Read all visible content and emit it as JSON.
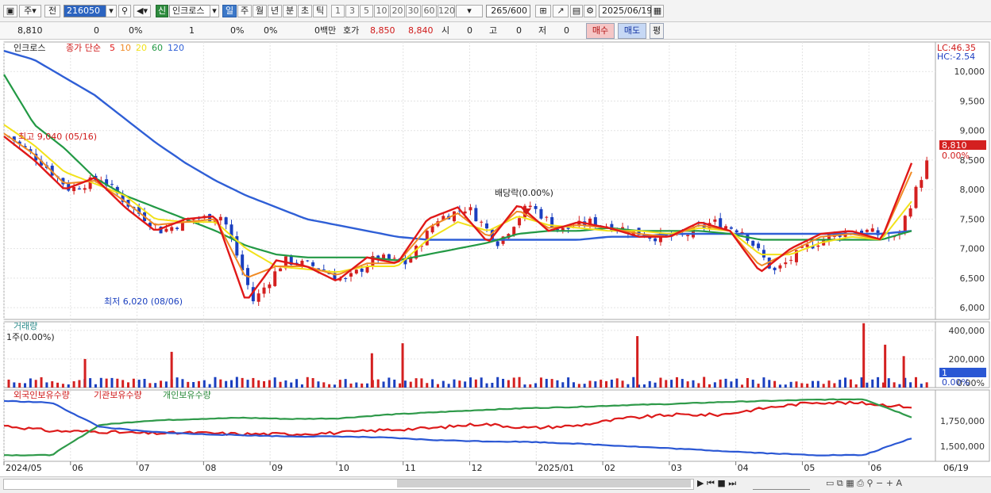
{
  "toolbar": {
    "period_unit": "주",
    "prev_label": "전",
    "stock_code": "216050",
    "credit_badge": "신",
    "stock_name": "인크로스",
    "timeframes": [
      "일",
      "주",
      "월",
      "년",
      "분",
      "초",
      "틱"
    ],
    "active_timeframe": "일",
    "minute_steps": [
      "1",
      "3",
      "5",
      "10",
      "20",
      "30",
      "60",
      "120"
    ],
    "bar_count": "265",
    "bar_total": "/600",
    "date": "2025/06/19"
  },
  "quote_bar": {
    "price": "8,810",
    "change": "0",
    "change_pct": "0%",
    "volume": "1",
    "vol_pct_1": "0%",
    "vol_pct_2": "0%",
    "amount": "0백만",
    "ask_label": "호가",
    "ask": "8,850",
    "bid": "8,840",
    "open_label": "시",
    "open": "0",
    "high_label": "고",
    "high": "0",
    "low_label": "저",
    "low": "0",
    "buy_label": "매수",
    "sell_label": "매도",
    "avg_label": "평"
  },
  "price_panel": {
    "name_tag": "인크로스",
    "ma_label": "종가 단순",
    "ma_periods": [
      "5",
      "10",
      "20",
      "60",
      "120"
    ],
    "lc": "LC:46.35",
    "hc": "HC:-2.54",
    "high_annotation": "최고 9,040 (05/16)",
    "low_annotation": "최저 6,020 (08/06)",
    "dividend_annotation": "배당락(0.00%)",
    "current_price_tag": "8,810",
    "current_pct_tag": "0.00%"
  },
  "volume_panel": {
    "title": "거래량",
    "unit_line": "1주(0.00%)",
    "current_tag": "1",
    "pct_tag": "0.00%"
  },
  "holdings_panel": {
    "series_labels": [
      "외국인보유수량",
      "기관보유수량",
      "개인보유수량"
    ]
  },
  "x_axis": {
    "labels": [
      "2024/05",
      "06",
      "07",
      "08",
      "09",
      "10",
      "11",
      "12",
      "2025/01",
      "02",
      "03",
      "04",
      "05",
      "06"
    ],
    "right_label": "06/19"
  },
  "colors": {
    "candle_up": "#d42020",
    "candle_down": "#1a3fbf",
    "ma5": "#e01818",
    "ma10": "#f08a24",
    "ma20": "#f2e21a",
    "ma60": "#229944",
    "ma120": "#2f5fd6",
    "foreign": "#dd1a1a",
    "institution": "#2f9a4a",
    "individual": "#2a57d4"
  },
  "chart_data": [
    {
      "type": "candlestick",
      "title": "인크로스",
      "y_ticks": [
        6000,
        6500,
        7000,
        7500,
        8000,
        8500,
        9000,
        9500,
        10000
      ],
      "ylim": [
        5800,
        10500
      ],
      "tick_labels": [
        "6,000",
        "6,500",
        "7,000",
        "7,500",
        "8,000",
        "8,500",
        "9,000",
        "9,500",
        "10,000"
      ],
      "x": [
        "2024/05",
        "06",
        "07",
        "08",
        "09",
        "10",
        "11",
        "12",
        "2025/01",
        "02",
        "03",
        "04",
        "05",
        "06"
      ],
      "close_path": [
        8900,
        8500,
        8000,
        8200,
        7700,
        7300,
        7500,
        7550,
        6100,
        6800,
        6700,
        6450,
        6850,
        6750,
        7500,
        7700,
        7100,
        7750,
        7300,
        7450,
        7350,
        7200,
        7200,
        7450,
        7300,
        6600,
        7000,
        7250,
        7300,
        7150,
        8450
      ],
      "series": [
        {
          "name": "5",
          "values": [
            8900,
            8500,
            8000,
            8200,
            7700,
            7300,
            7500,
            7550,
            6100,
            6800,
            6700,
            6450,
            6850,
            6750,
            7500,
            7700,
            7100,
            7750,
            7300,
            7450,
            7350,
            7200,
            7200,
            7450,
            7300,
            6600,
            7000,
            7250,
            7300,
            7150,
            8450
          ]
        },
        {
          "name": "10",
          "values": [
            8950,
            8600,
            8100,
            8150,
            7800,
            7400,
            7450,
            7500,
            6500,
            6700,
            6700,
            6550,
            6750,
            6750,
            7350,
            7600,
            7200,
            7650,
            7350,
            7400,
            7350,
            7250,
            7200,
            7400,
            7300,
            6700,
            6950,
            7200,
            7250,
            7150,
            8300
          ]
        },
        {
          "name": "20",
          "values": [
            9100,
            8750,
            8300,
            8100,
            7900,
            7500,
            7450,
            7450,
            7000,
            6700,
            6650,
            6600,
            6700,
            6700,
            7150,
            7450,
            7300,
            7550,
            7400,
            7350,
            7300,
            7300,
            7250,
            7350,
            7300,
            6900,
            6900,
            7100,
            7200,
            7150,
            7800
          ]
        },
        {
          "name": "60",
          "values": [
            9950,
            9100,
            8700,
            8200,
            7900,
            7700,
            7500,
            7300,
            7050,
            6900,
            6850,
            6850,
            6850,
            6800,
            6900,
            7000,
            7100,
            7250,
            7300,
            7300,
            7350,
            7300,
            7300,
            7300,
            7250,
            7150,
            7150,
            7150,
            7150,
            7150,
            7300
          ]
        },
        {
          "name": "120",
          "values": [
            10350,
            10200,
            9900,
            9600,
            9200,
            8800,
            8450,
            8150,
            7900,
            7700,
            7500,
            7400,
            7300,
            7200,
            7150,
            7150,
            7150,
            7150,
            7150,
            7150,
            7200,
            7200,
            7250,
            7250,
            7250,
            7250,
            7250,
            7250,
            7250,
            7250,
            7300
          ]
        }
      ]
    },
    {
      "type": "bar",
      "title": "거래량",
      "y_ticks": [
        0,
        200000,
        400000
      ],
      "tick_labels": [
        "0.00%",
        "200,000",
        "400,000"
      ],
      "ylim": [
        0,
        460000
      ],
      "spikes": [
        {
          "x": 0.087,
          "value": 200000
        },
        {
          "x": 0.18,
          "value": 250000
        },
        {
          "x": 0.395,
          "value": 240000
        },
        {
          "x": 0.428,
          "value": 310000
        },
        {
          "x": 0.68,
          "value": 360000
        },
        {
          "x": 0.923,
          "value": 450000
        },
        {
          "x": 0.946,
          "value": 300000
        },
        {
          "x": 0.966,
          "value": 220000
        }
      ]
    },
    {
      "type": "line",
      "title": "외국인보유수량 / 기관보유수량 / 개인보유수량",
      "y_ticks": [
        1500000,
        1750000
      ],
      "tick_labels": [
        "1,500,000",
        "1,750,000"
      ],
      "series": [
        {
          "name": "외국인보유수량",
          "values": [
            0.54,
            0.45,
            0.44,
            0.41,
            0.42,
            0.4,
            0.4,
            0.42,
            0.47,
            0.5,
            0.57,
            0.5,
            0.54,
            0.66,
            0.72,
            0.72,
            0.84,
            0.93,
            0.91,
            0.85
          ]
        },
        {
          "name": "기관보유수량",
          "values": [
            0.05,
            0.05,
            0.55,
            0.62,
            0.65,
            0.67,
            0.65,
            0.66,
            0.72,
            0.76,
            0.8,
            0.83,
            0.85,
            0.88,
            0.9,
            0.93,
            0.95,
            0.97,
            0.98,
            0.68
          ]
        },
        {
          "name": "개인보유수량",
          "values": [
            0.95,
            0.92,
            0.52,
            0.44,
            0.4,
            0.38,
            0.36,
            0.36,
            0.34,
            0.3,
            0.28,
            0.27,
            0.24,
            0.2,
            0.16,
            0.12,
            0.08,
            0.05,
            0.05,
            0.33
          ]
        }
      ]
    }
  ]
}
